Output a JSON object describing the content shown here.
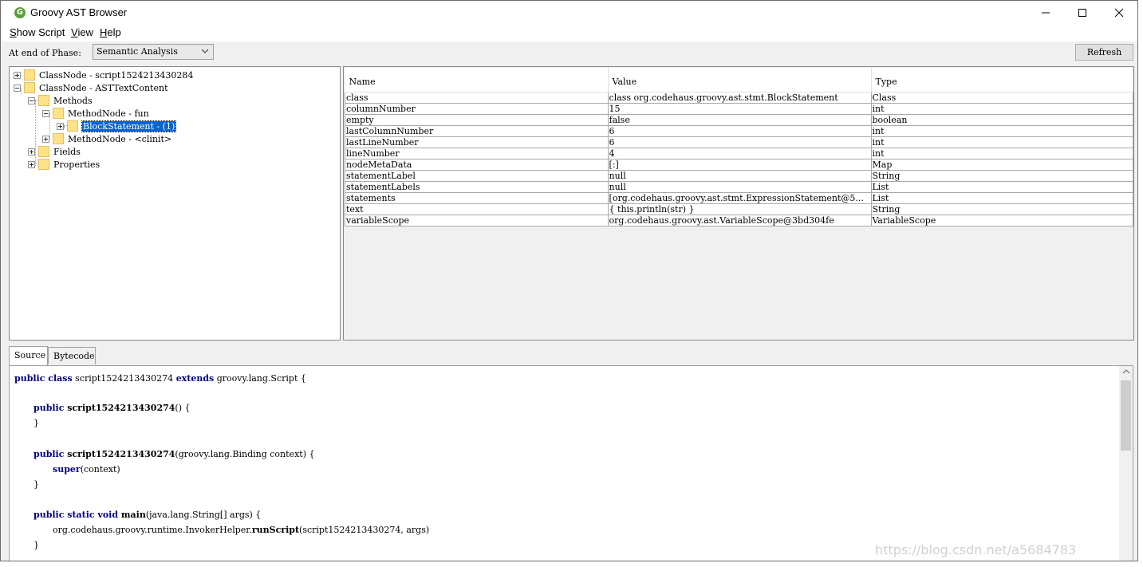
{
  "window": {
    "title": "Groovy AST Browser",
    "icon_letter": "G"
  },
  "menu": [
    {
      "label": "Show Script",
      "mnemonic": "S"
    },
    {
      "label": "View",
      "mnemonic": "V"
    },
    {
      "label": "Help",
      "mnemonic": "H"
    }
  ],
  "toolbar": {
    "phase_label": "At end of Phase:",
    "phase_value": "Semantic Analysis",
    "refresh_label": "Refresh"
  },
  "tree": [
    {
      "label": "ClassNode - script1524213430284"
    },
    {
      "label": "ClassNode - ASTTextContent"
    },
    {
      "label": "Methods"
    },
    {
      "label": "MethodNode - fun"
    },
    {
      "label": "BlockStatement - (1)"
    },
    {
      "label": "MethodNode - <clinit>"
    },
    {
      "label": "Fields"
    },
    {
      "label": "Properties"
    }
  ],
  "props": {
    "headers": [
      "Name",
      "Value",
      "Type"
    ],
    "rows": [
      [
        "class",
        "class org.codehaus.groovy.ast.stmt.BlockStatement",
        "Class"
      ],
      [
        "columnNumber",
        "15",
        "int"
      ],
      [
        "empty",
        "false",
        "boolean"
      ],
      [
        "lastColumnNumber",
        "6",
        "int"
      ],
      [
        "lastLineNumber",
        "6",
        "int"
      ],
      [
        "lineNumber",
        "4",
        "int"
      ],
      [
        "nodeMetaData",
        "[:]",
        "Map"
      ],
      [
        "statementLabel",
        "null",
        "String"
      ],
      [
        "statementLabels",
        "null",
        "List"
      ],
      [
        "statements",
        "[org.codehaus.groovy.ast.stmt.ExpressionStatement@5...",
        "List"
      ],
      [
        "text",
        "{ this.println(str) }",
        "String"
      ],
      [
        "variableScope",
        "org.codehaus.groovy.ast.VariableScope@3bd304fe",
        "VariableScope"
      ]
    ]
  },
  "tabs": [
    "Source",
    "Bytecode"
  ],
  "source": {
    "l1": {
      "kw": "public class",
      "t1": " script1524213430274 ",
      "kw2": "extends",
      "t2": " groovy.lang.Script {"
    },
    "l2": {
      "kw": "public",
      "m": " script1524213430274",
      "t": "() {"
    },
    "l3": "}",
    "l4": {
      "kw": "public",
      "m": " script1524213430274",
      "t": "(groovy.lang.Binding context) {"
    },
    "l5": {
      "kw": "super",
      "t": "(context)"
    },
    "l6": "}",
    "l7": {
      "kw": "public static void",
      "m": " main",
      "t": "(java.lang.String[] args) {"
    },
    "l8": {
      "t1": "org.codehaus.groovy.runtime.InvokerHelper.",
      "m": "runScript",
      "t2": "(script1524213430274, args)"
    },
    "l9": "}"
  },
  "watermark": "https://blog.csdn.net/a5684783"
}
